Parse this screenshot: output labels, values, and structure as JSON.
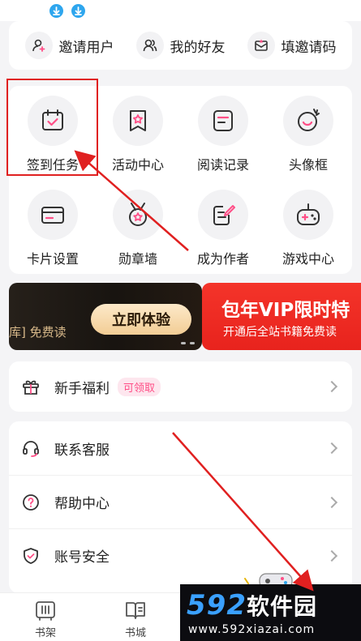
{
  "invite_row": [
    {
      "label": "邀请用户",
      "icon": "add-user-icon"
    },
    {
      "label": "我的好友",
      "icon": "friends-icon"
    },
    {
      "label": "填邀请码",
      "icon": "envelope-icon"
    }
  ],
  "grid": [
    {
      "label": "签到任务",
      "icon": "calendar-check-icon"
    },
    {
      "label": "活动中心",
      "icon": "star-flag-icon"
    },
    {
      "label": "阅读记录",
      "icon": "document-icon"
    },
    {
      "label": "头像框",
      "icon": "avatar-frame-icon"
    },
    {
      "label": "卡片设置",
      "icon": "card-icon"
    },
    {
      "label": "勋章墙",
      "icon": "medal-icon"
    },
    {
      "label": "成为作者",
      "icon": "pen-paper-icon"
    },
    {
      "label": "游戏中心",
      "icon": "gamepad-icon"
    }
  ],
  "banner_left": {
    "text": "库] 免费读",
    "button": "立即体验"
  },
  "banner_right": {
    "title": "包年VIP限时特",
    "subtitle": "开通后全站书籍免费读"
  },
  "welfare": {
    "label": "新手福利",
    "badge": "可领取"
  },
  "menu": [
    {
      "label": "联系客服",
      "icon": "headset-icon"
    },
    {
      "label": "帮助中心",
      "icon": "question-icon"
    },
    {
      "label": "账号安全",
      "icon": "shield-icon"
    }
  ],
  "bottom_nav": [
    {
      "label": "书架",
      "icon": "bookshelf-icon"
    },
    {
      "label": "书城",
      "icon": "bookstore-icon"
    }
  ],
  "watermark": {
    "brand_num": "592",
    "brand_cn": "软件园",
    "url": "www.592xiazai.com"
  },
  "colors": {
    "accent": "#ff4f87",
    "annotation": "#e02020",
    "banner_red": "#ef2c24"
  }
}
